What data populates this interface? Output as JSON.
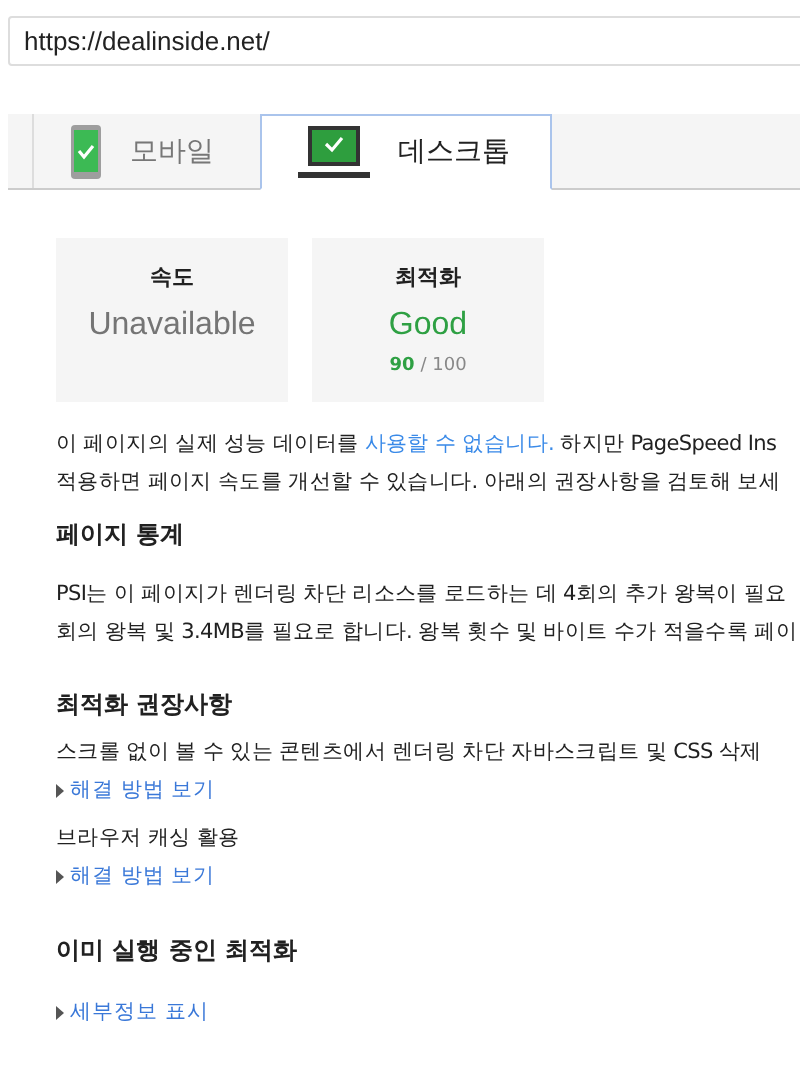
{
  "url_field": {
    "value": "https://dealinside.net/"
  },
  "tabs": [
    {
      "label": "모바일",
      "kind": "mobile",
      "selected": false
    },
    {
      "label": "데스크톱",
      "kind": "desktop",
      "selected": true
    }
  ],
  "scores": [
    {
      "title": "속도",
      "value": "Unavailable",
      "kind": "unavailable"
    },
    {
      "title": "최적화",
      "value": "Good",
      "kind": "good",
      "score": "90",
      "max": "/ 100"
    }
  ],
  "intro": [
    {
      "before": "이 페이지의 실제 성능 데이터를 ",
      "link": "사용할 수 없습니다.",
      "after": " 하지만 PageSpeed Ins"
    },
    {
      "before": "적용하면 페이지 속도를 개선할 수 있습니다. 아래의 권장사항을 검토해 보세"
    }
  ],
  "stats": {
    "heading": "페이지 통계",
    "lines": [
      "PSI는 이 페이지가 렌더링 차단 리소스를 로드하는 데 4회의 추가 왕복이 필요",
      "회의 왕복 및 3.4MB를 필요로 합니다. 왕복 횟수 및 바이트 수가 적을수록 페이"
    ]
  },
  "recommendations": {
    "heading": "최적화 권장사항",
    "items": [
      {
        "title": "스크롤 없이 볼 수 있는 콘텐츠에서 렌더링 차단 자바스크립트 및 CSS 삭제",
        "link": "해결 방법 보기"
      },
      {
        "title": "브라우저 캐싱 활용",
        "link": "해결 방법 보기"
      }
    ]
  },
  "done": {
    "heading": "이미 실행 중인 최적화",
    "link": "세부정보 표시"
  }
}
